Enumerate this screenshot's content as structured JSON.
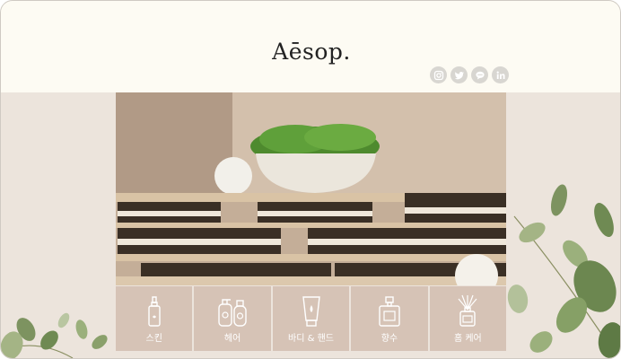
{
  "brand": {
    "logo": "Aēsop."
  },
  "social": [
    {
      "icon": "instagram-icon"
    },
    {
      "icon": "twitter-icon"
    },
    {
      "icon": "chat-icon"
    },
    {
      "icon": "linkedin-icon"
    }
  ],
  "categories": [
    {
      "label": "스킨",
      "icon": "serum-bottle-icon"
    },
    {
      "label": "헤어",
      "icon": "shampoo-bottles-icon"
    },
    {
      "label": "바디 & 핸드",
      "icon": "hand-cream-tube-icon"
    },
    {
      "label": "향수",
      "icon": "perfume-bottle-icon"
    },
    {
      "label": "홈 케어",
      "icon": "diffuser-icon"
    }
  ],
  "colors": {
    "header_bg": "#fdfbf3",
    "page_bg": "#ece4dc",
    "tile_bg": "#d6c3b6",
    "social_icon_bg": "#d8d6d1"
  }
}
